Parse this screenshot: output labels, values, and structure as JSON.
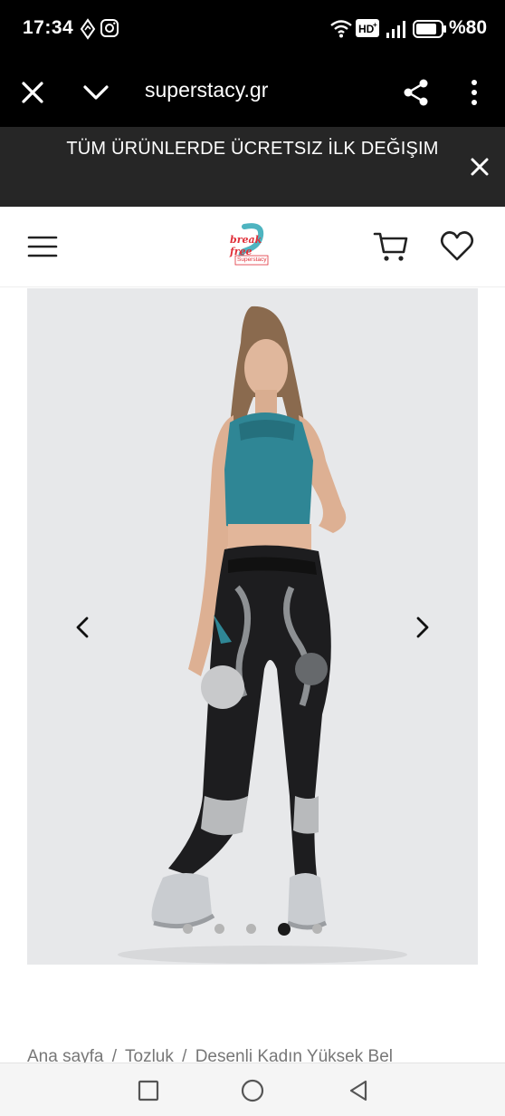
{
  "status_bar": {
    "time": "17:34",
    "battery_text": "%80",
    "icons": [
      "navigation-icon",
      "instagram-icon",
      "wifi-icon",
      "hd-icon",
      "signal-icon",
      "battery-icon"
    ]
  },
  "browser": {
    "url": "superstacy.gr",
    "icons": [
      "close-icon",
      "chevron-down-icon",
      "share-icon",
      "more-vertical-icon"
    ]
  },
  "announcement": {
    "text": "TÜM ÜRÜNLERDE ÜCRETSIZ İLK DEĞIŞIM"
  },
  "header": {
    "logo_text_top": "break free",
    "logo_text_bottom": "Superstacy",
    "icons": [
      "menu-icon",
      "cart-icon",
      "heart-icon"
    ]
  },
  "gallery": {
    "dots_count": 5,
    "active_dot": 3
  },
  "breadcrumb": {
    "items": [
      "Ana sayfa",
      "Tozluk",
      "Desenli Kadın Yüksek Bel"
    ],
    "separator": "/"
  },
  "colors": {
    "top_bar": "#000000",
    "announcement_bg": "#262626",
    "gallery_bg": "#e7e8ea",
    "logo_accent": "#e0303a",
    "logo_teal": "#2fa7b5"
  }
}
